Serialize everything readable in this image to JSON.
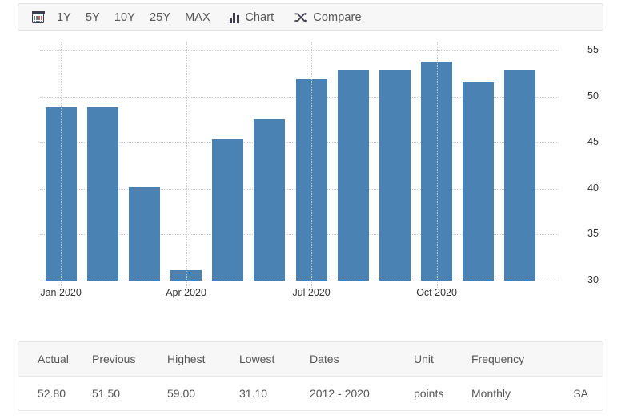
{
  "toolbar": {
    "calendar_icon": "calendar-icon",
    "ranges": [
      {
        "label": "1Y"
      },
      {
        "label": "5Y"
      },
      {
        "label": "10Y"
      },
      {
        "label": "25Y"
      },
      {
        "label": "MAX"
      }
    ],
    "chart_label": "Chart",
    "chart_icon": "bar-chart-icon",
    "compare_label": "Compare",
    "compare_icon": "shuffle-icon"
  },
  "colors": {
    "bar": "#4a82b4",
    "grid": "#c9c9c9",
    "toolbar_bg": "#f7f7f7",
    "border": "#e2e2e2",
    "text": "#555555"
  },
  "chart_data": {
    "type": "bar",
    "title": "",
    "subtitle": "",
    "xlabel": "",
    "ylabel": "",
    "grid": true,
    "legend": false,
    "ylim": [
      30,
      55
    ],
    "yticks": [
      30,
      35,
      40,
      45,
      50,
      55
    ],
    "xticks": [
      "Jan 2020",
      "Apr 2020",
      "Jul 2020",
      "Oct 2020"
    ],
    "xtick_indices": [
      0,
      3,
      6,
      9
    ],
    "categories": [
      "Jan 2020",
      "Feb 2020",
      "Mar 2020",
      "Apr 2020",
      "May 2020",
      "Jun 2020",
      "Jul 2020",
      "Aug 2020",
      "Sep 2020",
      "Oct 2020",
      "Nov 2020",
      "Dec 2020"
    ],
    "values": [
      48.8,
      48.8,
      40.2,
      31.1,
      45.4,
      47.5,
      51.9,
      52.8,
      52.8,
      53.8,
      51.5,
      52.8
    ],
    "unit": "points"
  },
  "stats": {
    "headers": [
      "Actual",
      "Previous",
      "Highest",
      "Lowest",
      "Dates",
      "Unit",
      "Frequency",
      ""
    ],
    "row": {
      "actual": "52.80",
      "previous": "51.50",
      "highest": "59.00",
      "lowest": "31.10",
      "dates": "2012 - 2020",
      "unit": "points",
      "frequency": "Monthly",
      "adjustment": "SA"
    }
  }
}
